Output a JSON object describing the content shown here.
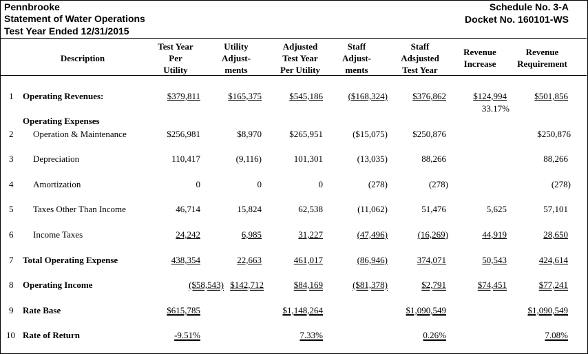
{
  "header": {
    "company": "Pennbrooke",
    "statement": "Statement of Water Operations",
    "period": "Test Year Ended 12/31/2015",
    "schedule": "Schedule No. 3-A",
    "docket": "Docket No. 160101-WS"
  },
  "columns": {
    "description": "Description",
    "test_year": [
      "Test Year",
      "Per",
      "Utility"
    ],
    "utility_adj": [
      "Utility",
      "Adjust-",
      "ments"
    ],
    "adjusted": [
      "Adjusted",
      "Test Year",
      "Per Utility"
    ],
    "staff_adj": [
      "Staff",
      "Adjust-",
      "ments"
    ],
    "staff_adjusted": [
      "Staff",
      "Adsjusted",
      "Test Year"
    ],
    "rev_increase": [
      "Revenue",
      "Increase"
    ],
    "rev_requirement": [
      "Revenue",
      "Requirement"
    ]
  },
  "rows": {
    "r1": {
      "num": "1",
      "label": "Operating Revenues:",
      "v": [
        "$379,811",
        "$165,375",
        "$545,186",
        "($168,324)",
        "$376,862",
        "$124,994",
        "$501,856"
      ],
      "pct": "33.17%"
    },
    "opex_heading": "Operating Expenses",
    "r2": {
      "num": "2",
      "label": "Operation & Maintenance",
      "v": [
        "$256,981",
        "$8,970",
        "$265,951",
        "($15,075)",
        "$250,876",
        "",
        "$250,876"
      ]
    },
    "r3": {
      "num": "3",
      "label": "Depreciation",
      "v": [
        "110,417",
        "(9,116)",
        "101,301",
        "(13,035)",
        "88,266",
        "",
        "88,266"
      ]
    },
    "r4": {
      "num": "4",
      "label": "Amortization",
      "v": [
        "0",
        "0",
        "0",
        "(278)",
        "(278)",
        "",
        "(278)"
      ]
    },
    "r5": {
      "num": "5",
      "label": "Taxes Other Than Income",
      "v": [
        "46,714",
        "15,824",
        "62,538",
        "(11,062)",
        "51,476",
        "5,625",
        "57,101"
      ]
    },
    "r6": {
      "num": "6",
      "label": "Income Taxes",
      "v": [
        "24,242",
        "6,985",
        "31,227",
        "(47,496)",
        "(16,269)",
        "44,919",
        "28,650"
      ]
    },
    "r7": {
      "num": "7",
      "label": "Total Operating Expense",
      "v": [
        "438,354",
        "22,663",
        "461,017",
        "(86,946)",
        "374,071",
        "50,543",
        "424,614"
      ]
    },
    "r8": {
      "num": "8",
      "label": "Operating Income",
      "v": [
        "($58,543)",
        "$142,712",
        "$84,169",
        "($81,378)",
        "$2,791",
        "$74,451",
        "$77,241"
      ]
    },
    "r9": {
      "num": "9",
      "label": "Rate Base",
      "v": [
        "$615,785",
        "",
        "$1,148,264",
        "",
        "$1,090,549",
        "",
        "$1,090,549"
      ]
    },
    "r10": {
      "num": "10",
      "label": "Rate of Return",
      "v": [
        "-9.51%",
        "",
        "7.33%",
        "",
        "0.26%",
        "",
        "7.08%"
      ]
    }
  }
}
